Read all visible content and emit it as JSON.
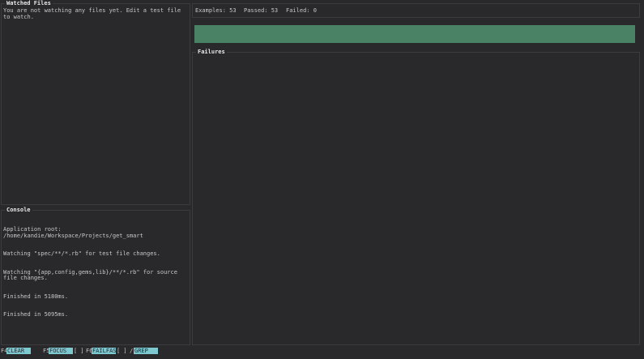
{
  "watched_files": {
    "title": "Watched Files",
    "message": "You are not watching any files yet. Edit a test file to watch."
  },
  "console": {
    "title": "Console",
    "lines": [
      "Application root: /home/kandie/Workspace/Projects/get_smart",
      "Watching \"spec/**/*.rb\" for test file changes.",
      "Watching \"{app,config,gems,lib}/**/*.rb\" for source file changes.",
      "Finished in 5180ms.",
      "Finished in 5095ms."
    ]
  },
  "summary": {
    "examples": "Examples: 53",
    "passed": "Passed: 53",
    "failed": "Failed: 0"
  },
  "progress": {
    "fraction": 1.0,
    "color": "#4a8265"
  },
  "failures": {
    "title": "Failures"
  },
  "footer": {
    "clear_key": "F4",
    "clear_label": "CLEAR",
    "focus_key": "F5",
    "focus_label": "FOCUS",
    "focus_state": "[ ]",
    "failfast_key": "F6",
    "failfast_label": "FAILFAST",
    "failfast_state": "[ ]",
    "grep_key": "/",
    "grep_label": "GREP"
  },
  "colors": {
    "background": "#29282b",
    "panel_border": "#3c3b3f",
    "text": "#c7c7c9",
    "keybar_accent": "#7ec8d0",
    "success": "#4a8265"
  }
}
